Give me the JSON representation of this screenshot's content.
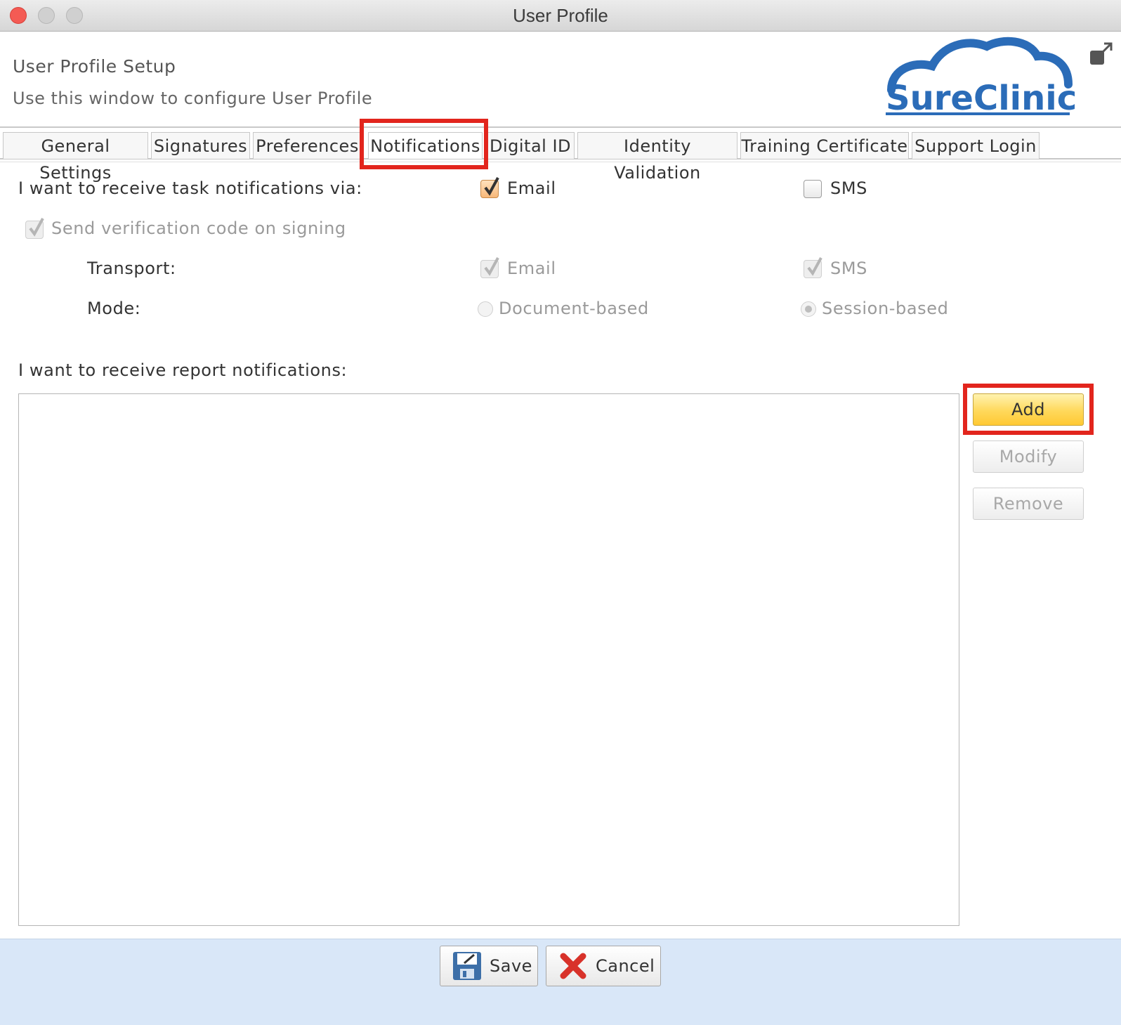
{
  "window": {
    "title": "User Profile"
  },
  "header": {
    "title": "User Profile Setup",
    "subtitle": "Use this window to configure User Profile",
    "logo_text": "SureClinical"
  },
  "tabs": [
    {
      "label": "General Settings"
    },
    {
      "label": "Signatures"
    },
    {
      "label": "Preferences"
    },
    {
      "label": "Notifications",
      "active": true
    },
    {
      "label": "Digital ID"
    },
    {
      "label": "Identity Validation"
    },
    {
      "label": "Training Certificate"
    },
    {
      "label": "Support Login"
    }
  ],
  "task_notifications": {
    "label": "I want to receive task notifications via:",
    "email": {
      "label": "Email",
      "checked": true
    },
    "sms": {
      "label": "SMS",
      "checked": false
    }
  },
  "verification": {
    "label": "Send verification code on signing",
    "checked": true,
    "enabled": false,
    "transport": {
      "label": "Transport:",
      "email": {
        "label": "Email",
        "checked": true
      },
      "sms": {
        "label": "SMS",
        "checked": true
      }
    },
    "mode": {
      "label": "Mode:",
      "options": [
        "Document-based",
        "Session-based"
      ],
      "selected": "Session-based"
    }
  },
  "report_notifications": {
    "label": "I want to receive report notifications:",
    "items": [],
    "buttons": {
      "add": "Add",
      "modify": "Modify",
      "remove": "Remove"
    }
  },
  "footer": {
    "save": "Save",
    "cancel": "Cancel"
  },
  "colors": {
    "highlight": "#e2251d",
    "brand_blue": "#2b6cb8",
    "footer_bg": "#d9e7f8"
  },
  "icons": [
    "expand-icon",
    "save-disk-icon",
    "cancel-x-icon",
    "cloud-logo"
  ]
}
